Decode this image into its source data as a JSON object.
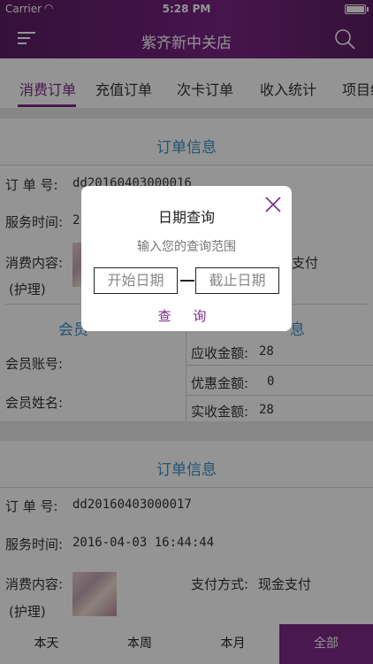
{
  "status_bar": {
    "carrier": "Carrier",
    "time": "5:28 PM"
  },
  "header": {
    "title": "紫齐新中关店",
    "menu_icon": "menu-icon",
    "search_icon": "search-icon"
  },
  "tabs": [
    {
      "label": "消费订单",
      "active": true
    },
    {
      "label": "充值订单",
      "active": false
    },
    {
      "label": "次卡订单",
      "active": false
    },
    {
      "label": "收入统计",
      "active": false
    },
    {
      "label": "项目统",
      "active": false
    }
  ],
  "orders": [
    {
      "section_title": "订单信息",
      "order_no_label": "订 单 号:",
      "order_no": "dd20160403000016",
      "service_time_label": "服务时间:",
      "service_time": "2",
      "content_label": "消费内容:",
      "content_note": "(护理)",
      "payment_label": "支付",
      "payment_value": "",
      "member_section": "会员",
      "amount_section": "息",
      "member_account_label": "会员账号:",
      "member_name_label": "会员姓名:",
      "receivable_label": "应收金额:",
      "receivable_value": "28",
      "discount_label": "优惠金额:",
      "discount_value": "0",
      "paid_label": "实收金额:",
      "paid_value": "28"
    },
    {
      "section_title": "订单信息",
      "order_no_label": "订 单 号:",
      "order_no": "dd20160403000017",
      "service_time_label": "服务时间:",
      "service_time": "2016-04-03 16:44:44",
      "content_label": "消费内容:",
      "content_note": "(护理)",
      "payment_label": "支付方式:",
      "payment_value": "现金支付"
    }
  ],
  "dialog": {
    "title": "日期查询",
    "hint": "输入您的查询范围",
    "start_placeholder": "开始日期",
    "end_placeholder": "截止日期",
    "query_button": "查 询",
    "close_icon": "close-icon"
  },
  "bottom_bar": [
    {
      "label": "本天",
      "active": false
    },
    {
      "label": "本周",
      "active": false
    },
    {
      "label": "本月",
      "active": false
    },
    {
      "label": "全部",
      "active": true
    }
  ],
  "colors": {
    "brand": "#7c2a87",
    "section_title": "#3b92c5"
  }
}
